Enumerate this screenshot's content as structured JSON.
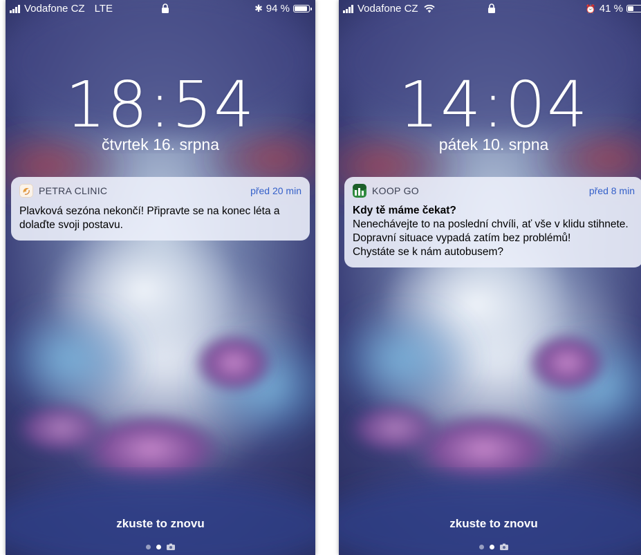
{
  "left": {
    "status": {
      "carrier": "Vodafone CZ",
      "network": "LTE",
      "bluetooth": "✱",
      "battery_text": "94 %",
      "battery_level": 0.94
    },
    "clock": "18:54",
    "date": "čtvrtek 16. srpna",
    "notification": {
      "app_name": "PETRA CLINIC",
      "time": "před 20 min",
      "title": "",
      "body": "Plavková sezóna nekončí! Připravte se na konec léta a dolaďte svoji postavu."
    },
    "unlock_hint": "zkuste to znovu"
  },
  "right": {
    "status": {
      "carrier": "Vodafone CZ",
      "alarm": "⏰",
      "battery_text": "41 %",
      "battery_level": 0.41
    },
    "clock": "14:04",
    "date": "pátek 10. srpna",
    "notification": {
      "app_name": "KOOP GO",
      "time": "před 8 min",
      "title": "Kdy tě máme čekat?",
      "body": "Nenechávejte to na poslední chvíli, ať vše v klidu stihnete.  Dopravní situace vypadá zatím bez problémů!\nChystáte se k nám autobusem?"
    },
    "unlock_hint": "zkuste to znovu"
  },
  "colors": {
    "link_blue": "#3460c9",
    "notification_bg": "#ebeefa"
  },
  "icons": [
    "signal-icon",
    "wifi-icon",
    "lock-icon",
    "bluetooth-icon",
    "alarm-icon",
    "battery-icon",
    "camera-icon",
    "petra-clinic-app-icon",
    "koop-go-app-icon"
  ]
}
